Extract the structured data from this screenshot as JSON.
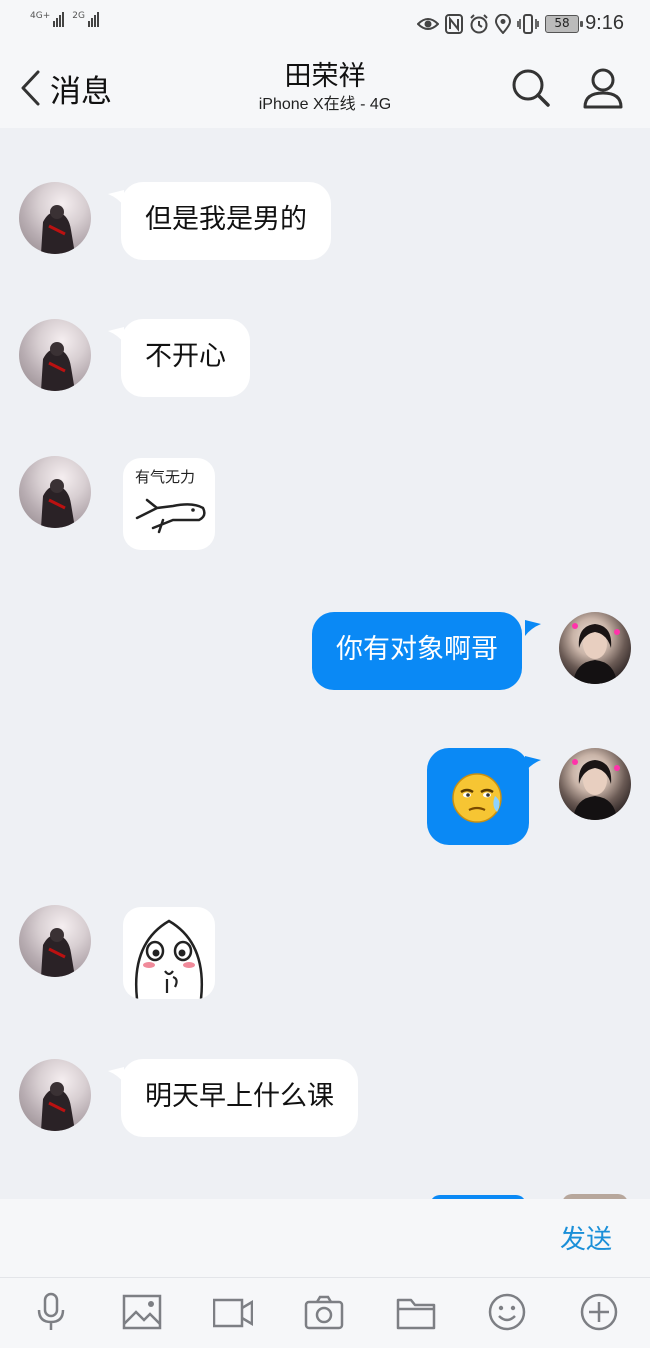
{
  "status_bar": {
    "signal1_label": "4G+",
    "signal2_label": "2G",
    "battery": "58",
    "time": "9:16"
  },
  "header": {
    "back_label": "消息",
    "contact_name": "田荣祥",
    "contact_status": "iPhone X在线 - 4G"
  },
  "messages": [
    {
      "from": "other",
      "text": "但是我是男的"
    },
    {
      "from": "other",
      "text": "不开心"
    },
    {
      "from": "other",
      "sticker_text": "有气无力"
    },
    {
      "from": "me",
      "text": "你有对象啊哥"
    },
    {
      "from": "me",
      "emoji": "😒"
    },
    {
      "from": "other",
      "sticker": "face"
    },
    {
      "from": "other",
      "text": "明天早上什么课"
    }
  ],
  "input": {
    "send_label": "发送"
  },
  "toolbar": {
    "items": [
      "mic-icon",
      "image-icon",
      "video-icon",
      "camera-icon",
      "folder-icon",
      "emoji-icon",
      "plus-icon"
    ]
  },
  "colors": {
    "accent": "#0a89f5",
    "send": "#1a8fd8",
    "background": "#eef0f4"
  }
}
